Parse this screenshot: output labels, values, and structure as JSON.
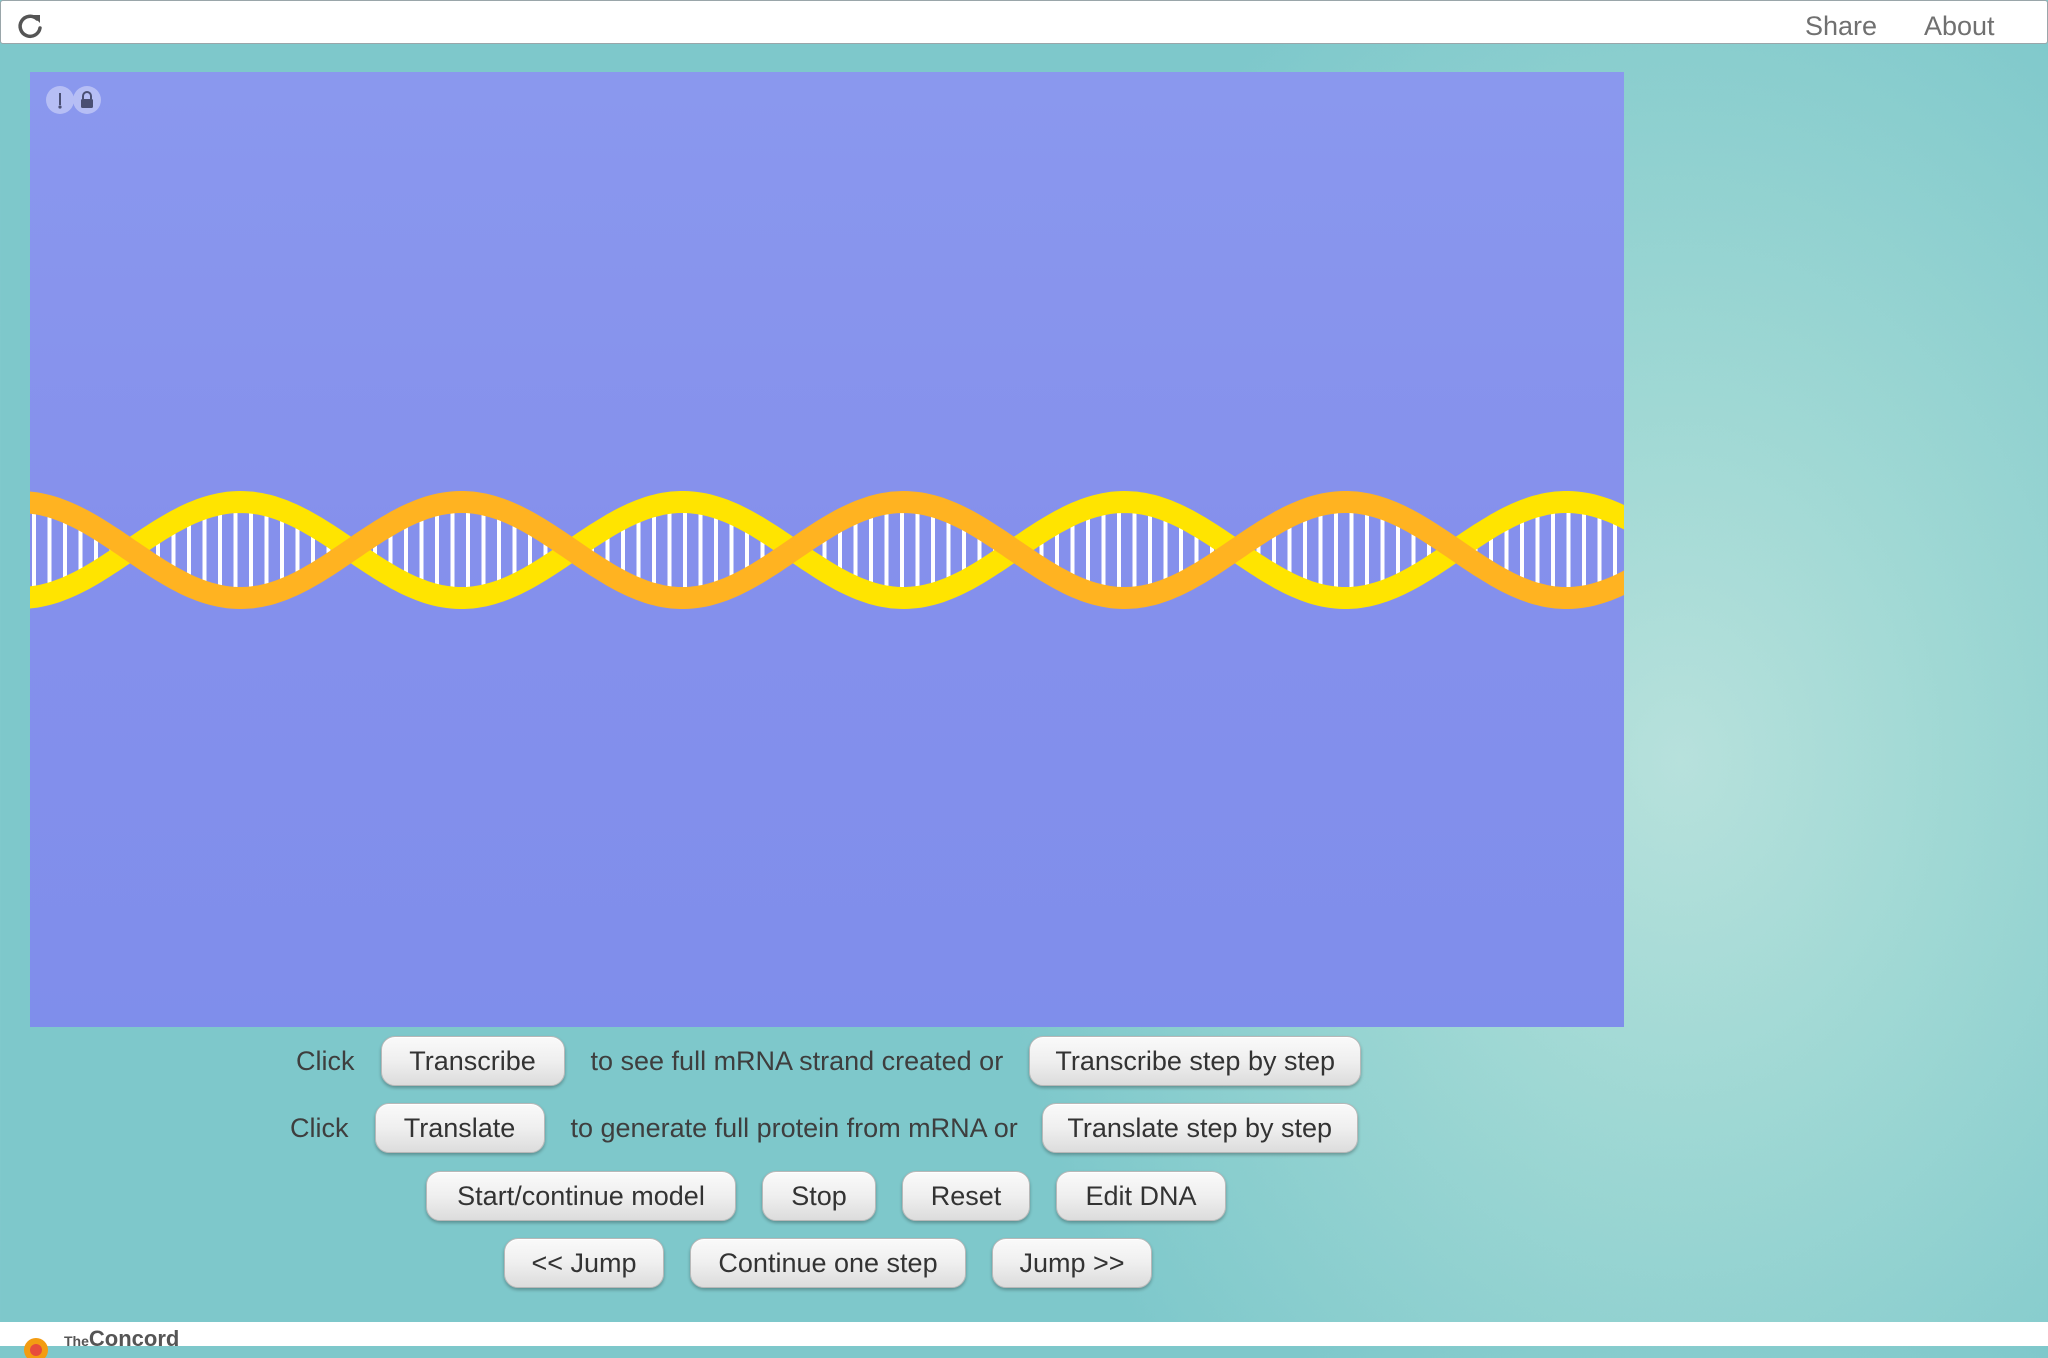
{
  "topbar": {
    "reload_icon": "reload-icon",
    "share_label": "Share",
    "about_label": "About"
  },
  "model": {
    "background_color": "#8590ec",
    "strand_colors": {
      "strand_a": "#ffe400",
      "strand_b": "#ffb321",
      "base_pairs": "#ffffff"
    },
    "controls": {
      "info_icon": "info-icon",
      "lock_icon": "lock-icon"
    }
  },
  "rows": {
    "transcribe": {
      "prefix": "Click",
      "button": "Transcribe",
      "middle": "to see full mRNA strand created or",
      "step_button": "Transcribe step by step"
    },
    "translate": {
      "prefix": "Click",
      "button": "Translate",
      "middle": "to generate full protein from mRNA or",
      "step_button": "Translate step by step"
    },
    "controls": {
      "start": "Start/continue model",
      "stop": "Stop",
      "reset": "Reset",
      "edit": "Edit DNA"
    },
    "navigation": {
      "jump_back": "<< Jump",
      "continue_step": "Continue one step",
      "jump_forward": "Jump >>"
    }
  },
  "footer": {
    "logo_icon": "concord-logo-icon",
    "small_text": "The",
    "text": "Concord"
  }
}
